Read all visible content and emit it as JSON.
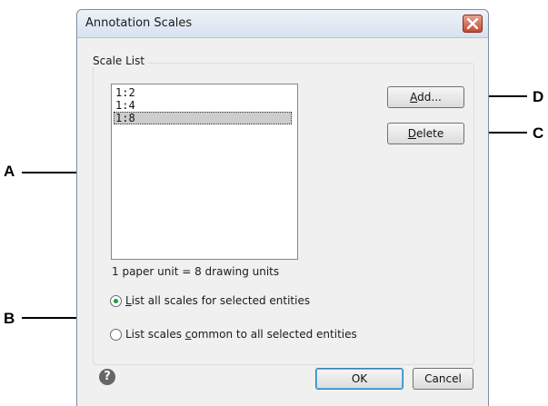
{
  "window": {
    "title": "Annotation Scales"
  },
  "scale_list": {
    "group_title": "Scale List",
    "items": [
      {
        "label": "1:2",
        "selected": false
      },
      {
        "label": "1:4",
        "selected": false
      },
      {
        "label": "1:8",
        "selected": true
      }
    ]
  },
  "buttons": {
    "add_prefix": "A",
    "add_rest": "dd...",
    "delete_prefix": "D",
    "delete_rest": "elete",
    "ok": "OK",
    "cancel": "Cancel"
  },
  "info": {
    "unit_text": "1 paper unit = 8 drawing units"
  },
  "radios": [
    {
      "prefix": "L",
      "rest": "ist all scales for selected entities",
      "checked": true
    },
    {
      "pre": "List scales ",
      "u": "c",
      "post": "ommon to all selected entities",
      "checked": false
    }
  ],
  "callouts": {
    "a": "A",
    "b": "B",
    "c": "C",
    "d": "D"
  },
  "help": {
    "glyph": "?"
  }
}
